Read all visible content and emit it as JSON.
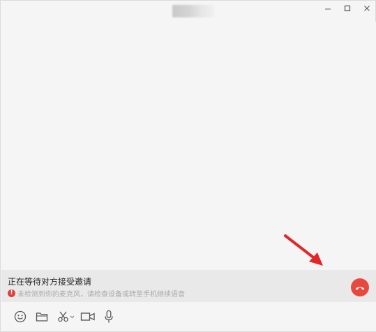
{
  "titlebar": {
    "contact_avatar_icon": "blurred-contact-avatar",
    "minimize_icon": "minimize-icon",
    "maximize_icon": "maximize-icon",
    "close_icon": "close-icon"
  },
  "call": {
    "status_title": "正在等待对方接受邀请",
    "warning_text": "未检测到你的麦克风，请检查设备或转至手机继续语音",
    "hangup_color": "#e8493f"
  },
  "toolbar": {
    "icons": [
      "emoji-icon",
      "folder-icon",
      "scissors-icon",
      "video-call-icon",
      "microphone-icon"
    ]
  },
  "colors": {
    "warning": "#e0403a",
    "hangup": "#e8493f",
    "arrow": "#e0282a",
    "background": "#f5f5f5",
    "status_bar": "#e9e9e9"
  }
}
